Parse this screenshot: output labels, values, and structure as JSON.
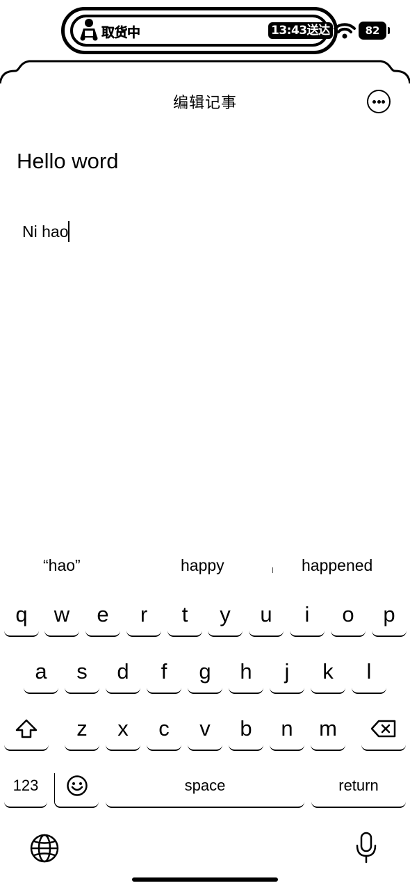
{
  "status_bar": {
    "delivery_label": "取货中",
    "time_label": "13:43送达",
    "battery_label": "82",
    "icons": [
      "delivery-person-icon",
      "wifi-icon",
      "battery-icon"
    ]
  },
  "nav": {
    "title": "编辑记事",
    "more_icon": "ellipsis-circle-icon"
  },
  "note": {
    "title": "Hello word",
    "body": "Ni hao"
  },
  "keyboard": {
    "suggestions": [
      "“hao”",
      "happy",
      "happened"
    ],
    "row1": [
      "q",
      "w",
      "e",
      "r",
      "t",
      "y",
      "u",
      "i",
      "o",
      "p"
    ],
    "row2": [
      "a",
      "s",
      "d",
      "f",
      "g",
      "h",
      "j",
      "k",
      "l"
    ],
    "row3": [
      "z",
      "x",
      "c",
      "v",
      "b",
      "n",
      "m"
    ],
    "numbers_label": "123",
    "space_label": "space",
    "return_label": "return",
    "icons": [
      "shift-icon",
      "delete-icon",
      "emoji-icon",
      "globe-icon",
      "microphone-icon"
    ]
  }
}
